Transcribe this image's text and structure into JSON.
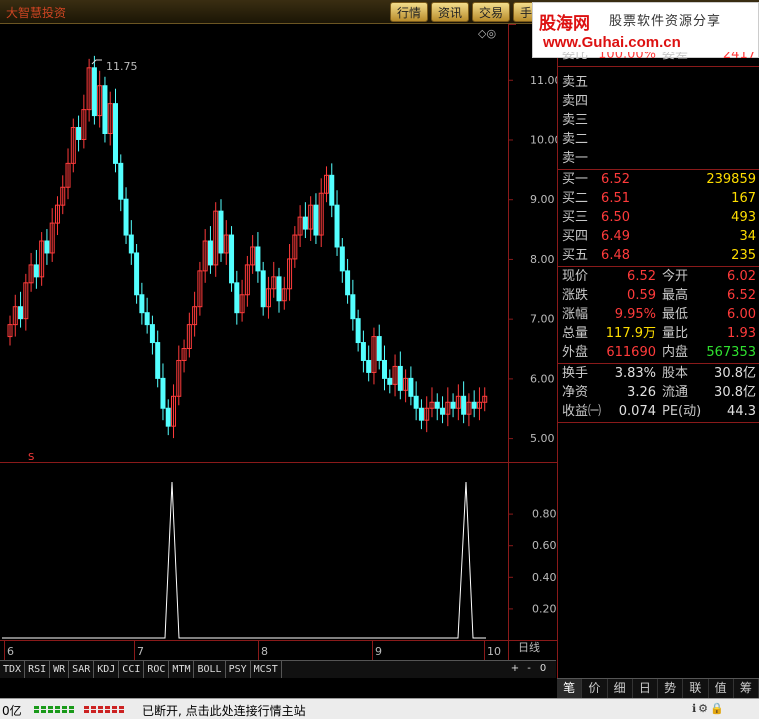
{
  "topbar": {
    "title": "大智慧投资",
    "tabs": [
      "行情",
      "资讯",
      "交易",
      "手"
    ]
  },
  "watermark": {
    "logo": "股海网",
    "slogan": "股票软件资源分享",
    "url": "www.Guhai.com.cn"
  },
  "chart": {
    "high_label": "11.75",
    "price_ticks": [
      "11.00",
      "10.00",
      "9.00",
      "8.00",
      "7.00",
      "6.00",
      "5.00"
    ],
    "indicator_ticks": [
      "0.80",
      "0.60",
      "0.40",
      "0.20"
    ],
    "month_labels": [
      "6",
      "7",
      "8",
      "9",
      "10"
    ],
    "period": "日线",
    "signal_mark": "S",
    "top_icons": "◇◎"
  },
  "chart_data": {
    "type": "candlestick",
    "x_labels": [
      "6",
      "7",
      "8",
      "9",
      "10"
    ],
    "y_ticks": [
      5.0,
      6.0,
      7.0,
      8.0,
      9.0,
      10.0,
      11.0
    ],
    "ylim": [
      4.6,
      11.9
    ],
    "annotations": [
      {
        "text": "11.75",
        "at": "max high"
      }
    ],
    "indicator": {
      "type": "line",
      "ylim": [
        0,
        1
      ],
      "ticks": [
        0.2,
        0.4,
        0.6,
        0.8
      ],
      "spikes_at_months": [
        "7",
        "10"
      ],
      "spike_value": 1.0
    }
  },
  "indicators": [
    "TDX",
    "RSI",
    "WR",
    "SAR",
    "KDJ",
    "CCI",
    "ROC",
    "MTM",
    "BOLL",
    "PSY",
    "MCST"
  ],
  "indicator_controls": [
    "+",
    "-",
    "0"
  ],
  "panel": {
    "header_cut": {
      "left": "委比",
      "left_val": "100.00%",
      "right": "委差",
      "right_val": "2417"
    },
    "sell": [
      {
        "label": "卖五",
        "price": "",
        "vol": ""
      },
      {
        "label": "卖四",
        "price": "",
        "vol": ""
      },
      {
        "label": "卖三",
        "price": "",
        "vol": ""
      },
      {
        "label": "卖二",
        "price": "",
        "vol": ""
      },
      {
        "label": "卖一",
        "price": "",
        "vol": ""
      }
    ],
    "buy": [
      {
        "label": "买一",
        "price": "6.52",
        "vol": "239859"
      },
      {
        "label": "买二",
        "price": "6.51",
        "vol": "167"
      },
      {
        "label": "买三",
        "price": "6.50",
        "vol": "493"
      },
      {
        "label": "买四",
        "price": "6.49",
        "vol": "34"
      },
      {
        "label": "买五",
        "price": "6.48",
        "vol": "235"
      }
    ],
    "quote": [
      {
        "l1": "现价",
        "v1": "6.52",
        "c1": "red",
        "l2": "今开",
        "v2": "6.02",
        "c2": "red"
      },
      {
        "l1": "涨跌",
        "v1": "0.59",
        "c1": "red",
        "l2": "最高",
        "v2": "6.52",
        "c2": "red"
      },
      {
        "l1": "涨幅",
        "v1": "9.95%",
        "c1": "red",
        "l2": "最低",
        "v2": "6.00",
        "c2": "red"
      },
      {
        "l1": "总量",
        "v1": "117.9万",
        "c1": "yellow",
        "l2": "量比",
        "v2": "1.93",
        "c2": "red"
      },
      {
        "l1": "外盘",
        "v1": "611690",
        "c1": "red",
        "l2": "内盘",
        "v2": "567353",
        "c2": "green"
      }
    ],
    "finance": [
      {
        "l1": "换手",
        "v1": "3.83%",
        "l2": "股本",
        "v2": "30.8亿"
      },
      {
        "l1": "净资",
        "v1": "3.26",
        "l2": "流通",
        "v2": "30.8亿"
      },
      {
        "l1": "收益㈠",
        "v1": "0.074",
        "l2": "PE(动)",
        "v2": "44.3"
      }
    ],
    "tabs": [
      "笔",
      "价",
      "细",
      "日",
      "势",
      "联",
      "值",
      "筹"
    ]
  },
  "status": {
    "left": "0亿",
    "message": "已断开, 点击此处连接行情主站",
    "icons": "ℹ⚙🔒"
  },
  "colors": {
    "up": "#ff3b3b",
    "down": "#54ffff",
    "grid": "#8a1a1a",
    "yellow": "#ffde00",
    "green": "#2fe12f"
  }
}
